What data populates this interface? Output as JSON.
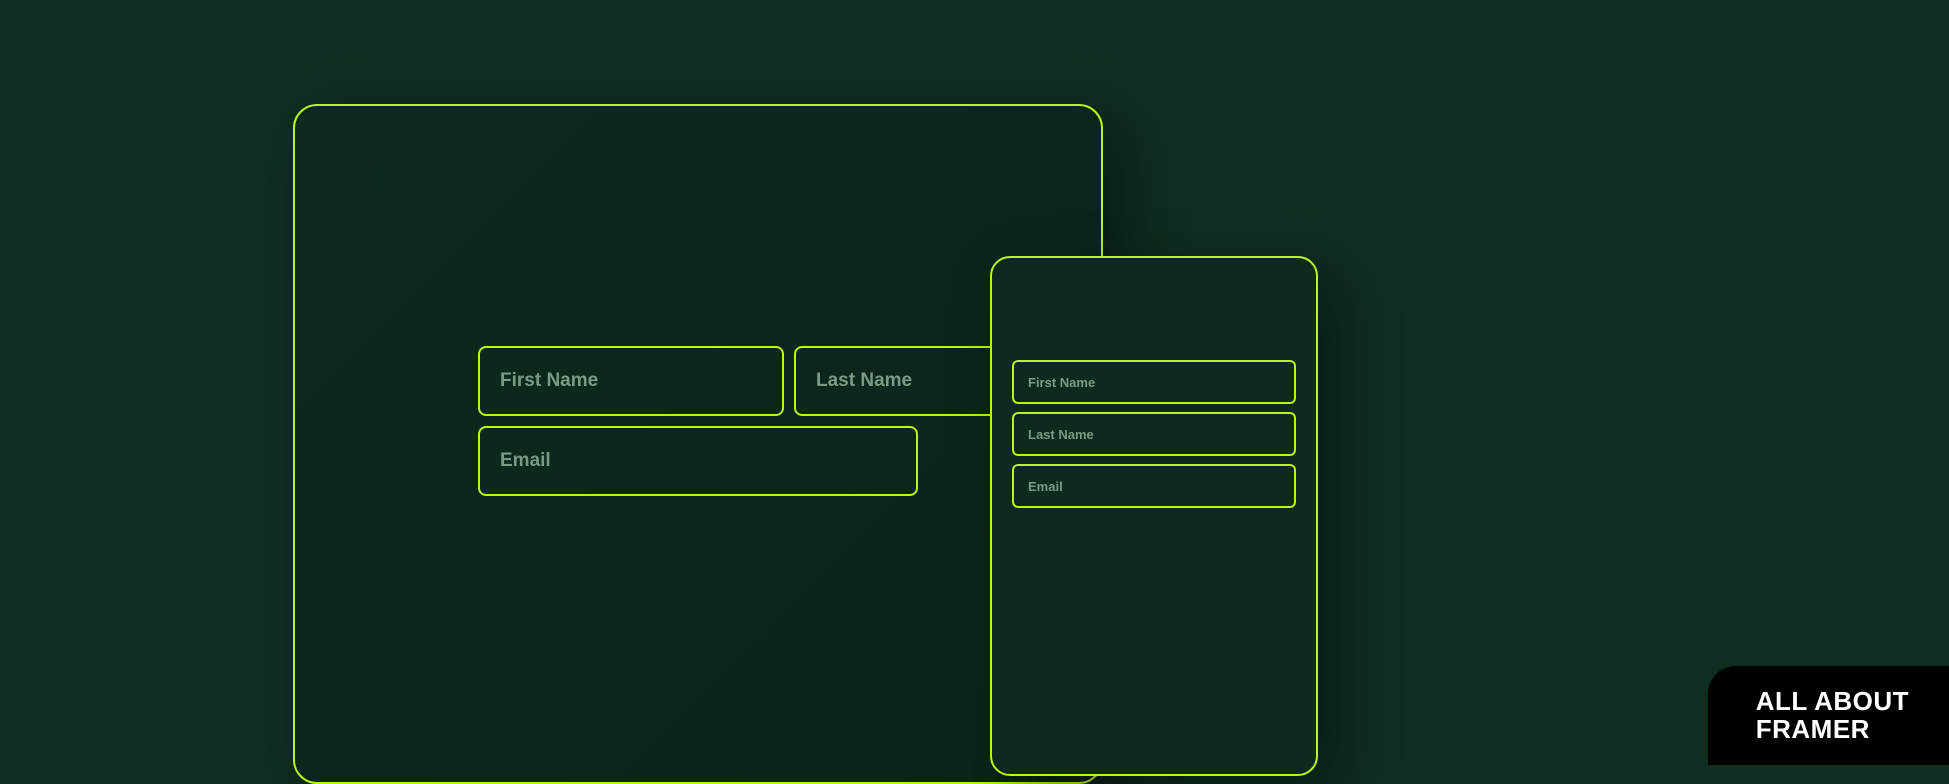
{
  "desktop": {
    "form": {
      "first_name_placeholder": "First Name",
      "last_name_placeholder": "Last Name",
      "email_placeholder": "Email"
    }
  },
  "mobile": {
    "form": {
      "first_name_placeholder": "First Name",
      "last_name_placeholder": "Last Name",
      "email_placeholder": "Email"
    }
  },
  "brand": {
    "line_1": "ALL ABOUT",
    "line_2": "FRAMER"
  },
  "colors": {
    "background": "#0f2e1f",
    "accent": "#b8f520",
    "placeholder": "#7a9a85",
    "badge_bg": "#000000"
  }
}
